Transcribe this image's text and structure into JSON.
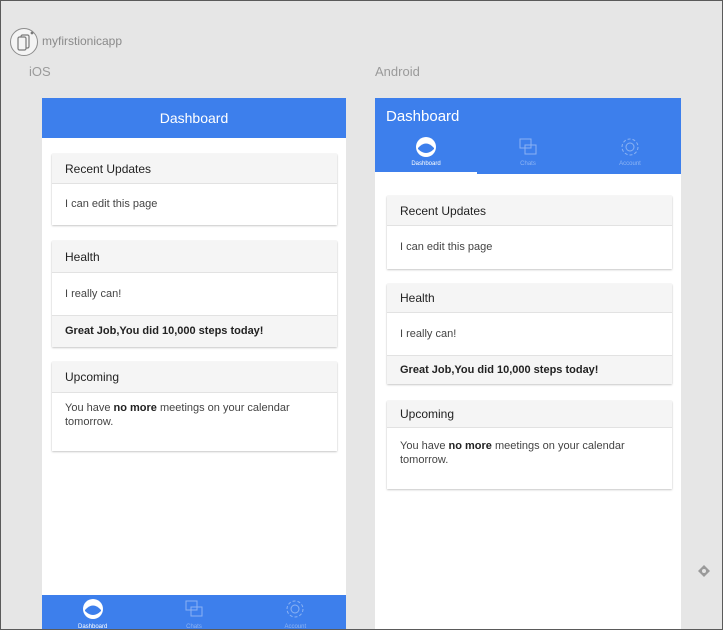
{
  "app": {
    "name": "myfirstionicapp"
  },
  "platforms": {
    "ios": "iOS",
    "android": "Android"
  },
  "header": {
    "title": "Dashboard"
  },
  "tabs": [
    {
      "label": "Dashboard",
      "icon": "dashboard-icon",
      "active": true
    },
    {
      "label": "Chats",
      "icon": "chats-icon",
      "active": false
    },
    {
      "label": "Account",
      "icon": "account-gear-icon",
      "active": false
    }
  ],
  "cards": {
    "recent": {
      "title": "Recent Updates",
      "item": "I can edit this page"
    },
    "health": {
      "title": "Health",
      "item": "I really can!",
      "highlight": "Great Job,You did 10,000 steps today!"
    },
    "upcoming": {
      "title": "Upcoming",
      "text_before": "You have ",
      "text_bold": "no more",
      "text_after": " meetings on your calendar tomorrow."
    }
  },
  "colors": {
    "accent": "#3d7fec",
    "background": "#e6e6e6"
  }
}
